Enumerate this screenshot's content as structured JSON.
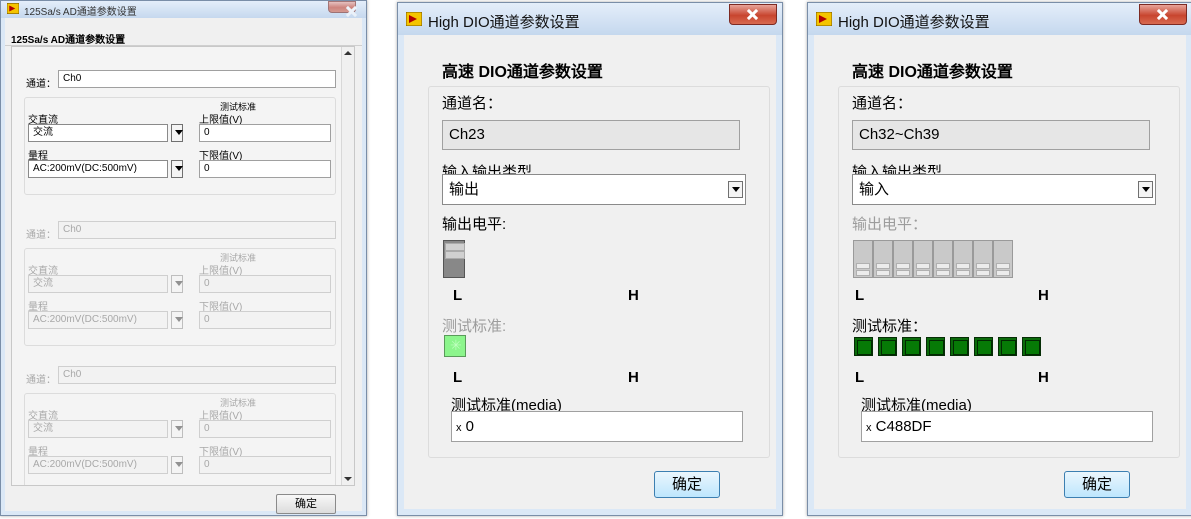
{
  "win1": {
    "title": "125Sa/s AD通道参数设置",
    "heading": "125Sa/s AD通道参数设置",
    "channels": [
      {
        "channel_label": "通道：",
        "channel_value": "Ch0",
        "test_std_label": "测试标准",
        "acdc_label": "交直流",
        "acdc_value": "交流",
        "upper_label": "上限值(V)",
        "upper_value": "0",
        "range_label": "量程",
        "range_value": "AC:200mV(DC:500mV)",
        "lower_label": "下限值(V)",
        "lower_value": "0"
      },
      {
        "channel_label": "通道：",
        "channel_value": "Ch0",
        "test_std_label": "测试标准",
        "acdc_label": "交直流",
        "acdc_value": "交流",
        "upper_label": "上限值(V)",
        "upper_value": "0",
        "range_label": "量程",
        "range_value": "AC:200mV(DC:500mV)",
        "lower_label": "下限值(V)",
        "lower_value": "0"
      },
      {
        "channel_label": "通道：",
        "channel_value": "Ch0",
        "test_std_label": "测试标准",
        "acdc_label": "交直流",
        "acdc_value": "交流",
        "upper_label": "上限值(V)",
        "upper_value": "0",
        "range_label": "量程",
        "range_value": "AC:200mV(DC:500mV)",
        "lower_label": "下限值(V)",
        "lower_value": "0"
      }
    ],
    "ok": "确定"
  },
  "win2": {
    "title": "High DIO通道参数设置",
    "heading": "高速 DIO通道参数设置",
    "channel_name_label": "通道名：",
    "channel_name": "Ch23",
    "io_type_label": "输入输出类型",
    "io_type": "输出",
    "output_level_label": "输出电平:",
    "L": "L",
    "H": "H",
    "test_std_label": "测试标准:",
    "L2": "L",
    "H2": "H",
    "media_label": "测试标准(media)",
    "media_prefix": "x",
    "media_value": "0",
    "ok": "确定"
  },
  "win3": {
    "title": "High DIO通道参数设置",
    "heading": "高速 DIO通道参数设置",
    "channel_name_label": "通道名：",
    "channel_name": "Ch32~Ch39",
    "io_type_label": "输入输出类型",
    "io_type": "输入",
    "output_level_label": "输出电平：",
    "L": "L",
    "H": "H",
    "test_std_label": "测试标准：",
    "L2": "L",
    "H2": "H",
    "media_label": "测试标准(media)",
    "media_prefix": "x",
    "media_value": "C488DF",
    "ok": "确定"
  },
  "icons": [
    "labview-app-icon",
    "close-icon",
    "dropdown-arrow-icon",
    "scroll-up-icon",
    "scroll-down-icon"
  ],
  "colors": {
    "led_on": "#0b6b0b",
    "led_lit": "#8cf58c",
    "button_blue": "#bee6fd",
    "close_red": "#c8452f"
  }
}
